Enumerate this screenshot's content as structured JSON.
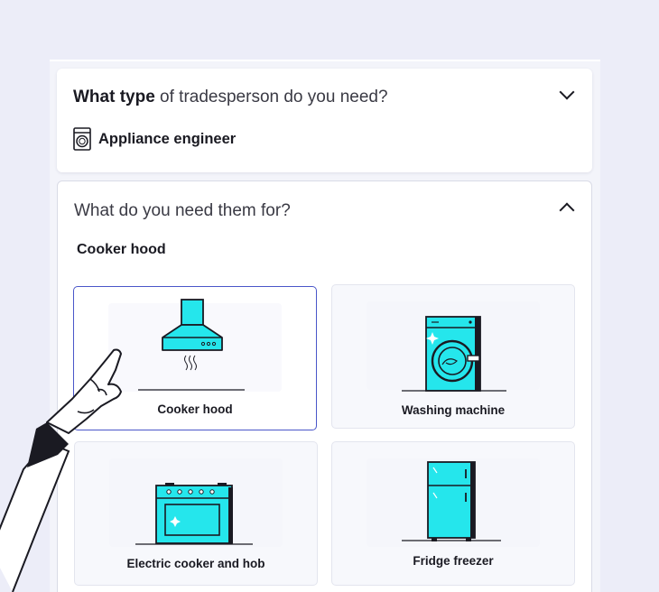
{
  "question1": {
    "bold": "What type",
    "rest": " of tradesperson do you need?",
    "selected": "Appliance engineer",
    "icon": "washing-machine-icon"
  },
  "question2": {
    "text": "What do you need them for?",
    "selected": "Cooker hood"
  },
  "options": [
    {
      "label": "Cooker hood",
      "icon": "cooker-hood-icon",
      "selected": true
    },
    {
      "label": "Washing machine",
      "icon": "washing-machine-icon",
      "selected": false
    },
    {
      "label": "Electric cooker and  hob",
      "icon": "oven-icon",
      "selected": false
    },
    {
      "label": "Fridge freezer",
      "icon": "fridge-icon",
      "selected": false
    }
  ],
  "colors": {
    "accent": "#25e6ec",
    "selected_border": "#4a56c9",
    "background": "#ecedf8"
  }
}
